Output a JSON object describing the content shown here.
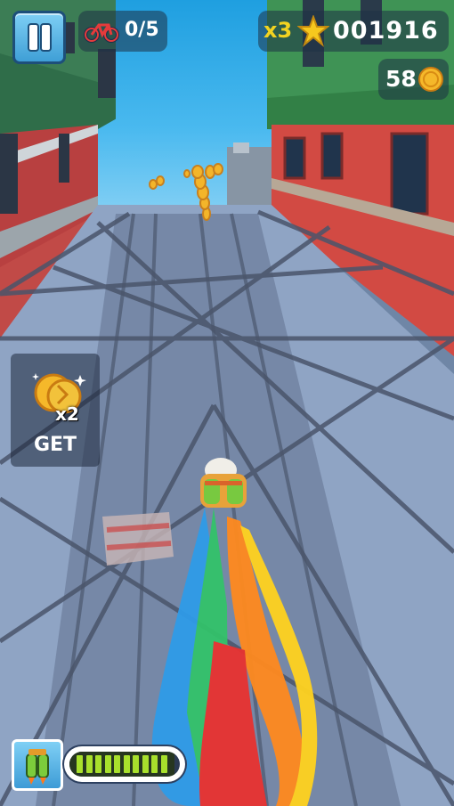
{
  "hud": {
    "mission_progress": "0/5",
    "score_multiplier": "x3",
    "score": "001916",
    "coins": "58",
    "powerup_label": "GET",
    "powerup_badge": "x2",
    "jetpack_meter_fraction": 0.95,
    "jetpack_segments": 10
  },
  "icons": {
    "pause": "pause-icon",
    "mission": "bicycle-icon",
    "score": "star-icon",
    "coin": "coin-icon",
    "powerup": "double-coins-icon",
    "jetpack": "jetpack-icon"
  },
  "colors": {
    "multiplier": "#f2d321",
    "meter_fill": "#a8e02c",
    "sky": "#1f9fe0",
    "roof_left": "#3c8a5a",
    "wall_right": "#d24a43"
  }
}
